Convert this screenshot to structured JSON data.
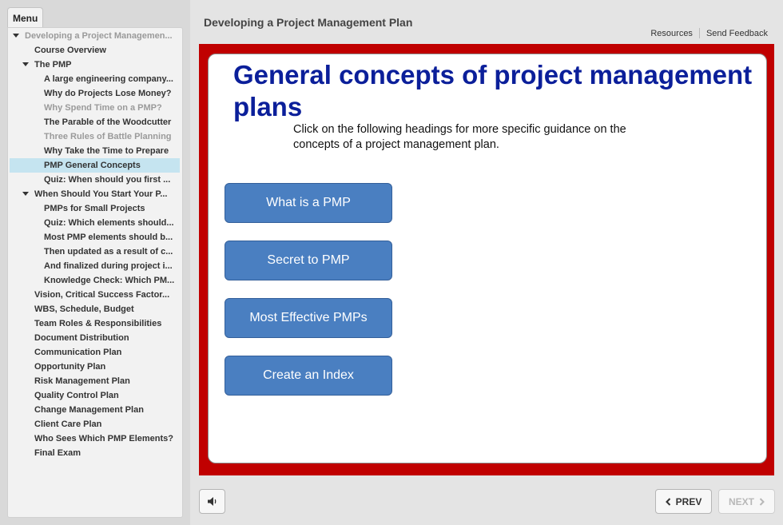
{
  "sidebar": {
    "tab_label": "Menu",
    "items": [
      {
        "label": "Developing a Project Managemen...",
        "level": 0,
        "expanded": true,
        "state": "dim"
      },
      {
        "label": "Course Overview",
        "level": 1,
        "state": "normal"
      },
      {
        "label": "The PMP",
        "level": 0,
        "expanded": true,
        "state": "normal",
        "indent": 1
      },
      {
        "label": "A large engineering company...",
        "level": 2,
        "state": "normal"
      },
      {
        "label": "Why do Projects Lose Money?",
        "level": 2,
        "state": "normal"
      },
      {
        "label": "Why Spend Time on a PMP?",
        "level": 2,
        "state": "dim"
      },
      {
        "label": "The Parable of the Woodcutter",
        "level": 2,
        "state": "normal"
      },
      {
        "label": "Three Rules of Battle Planning",
        "level": 2,
        "state": "dim"
      },
      {
        "label": "Why Take the Time to Prepare",
        "level": 2,
        "state": "normal"
      },
      {
        "label": "PMP General Concepts",
        "level": 2,
        "state": "active"
      },
      {
        "label": "Quiz: When should you first ...",
        "level": 2,
        "state": "normal"
      },
      {
        "label": "When Should You Start Your P...",
        "level": 0,
        "expanded": true,
        "state": "normal",
        "indent": 1
      },
      {
        "label": "PMPs for Small Projects",
        "level": 2,
        "state": "normal"
      },
      {
        "label": "Quiz: Which elements should...",
        "level": 2,
        "state": "normal"
      },
      {
        "label": "Most PMP elements should b...",
        "level": 2,
        "state": "normal"
      },
      {
        "label": "Then updated as a result of c...",
        "level": 2,
        "state": "normal"
      },
      {
        "label": "And finalized during project i...",
        "level": 2,
        "state": "normal"
      },
      {
        "label": "Knowledge Check: Which PM...",
        "level": 2,
        "state": "normal"
      },
      {
        "label": "Vision, Critical Success Factor...",
        "level": 1,
        "state": "normal"
      },
      {
        "label": "WBS, Schedule, Budget",
        "level": 1,
        "state": "normal"
      },
      {
        "label": "Team Roles & Responsibilities",
        "level": 1,
        "state": "normal"
      },
      {
        "label": "Document Distribution",
        "level": 1,
        "state": "normal"
      },
      {
        "label": "Communication Plan",
        "level": 1,
        "state": "normal"
      },
      {
        "label": "Opportunity Plan",
        "level": 1,
        "state": "normal"
      },
      {
        "label": "Risk Management Plan",
        "level": 1,
        "state": "normal"
      },
      {
        "label": "Quality Control Plan",
        "level": 1,
        "state": "normal"
      },
      {
        "label": "Change Management Plan",
        "level": 1,
        "state": "normal"
      },
      {
        "label": "Client Care Plan",
        "level": 1,
        "state": "normal"
      },
      {
        "label": "Who Sees Which PMP Elements?",
        "level": 1,
        "state": "normal"
      },
      {
        "label": "Final Exam",
        "level": 1,
        "state": "normal"
      }
    ]
  },
  "header": {
    "course_title": "Developing a Project Management Plan",
    "resources_label": "Resources",
    "feedback_label": "Send Feedback"
  },
  "slide": {
    "title": "General concepts of project management plans",
    "subtitle": "Click on the following headings for more specific guidance on the concepts of a project management plan.",
    "buttons": [
      {
        "label": "What is a PMP"
      },
      {
        "label": "Secret to PMP"
      },
      {
        "label": "Most Effective PMPs"
      },
      {
        "label": "Create an Index"
      }
    ]
  },
  "footer": {
    "audio_icon": "speaker-icon",
    "prev_label": "PREV",
    "next_label": "NEXT",
    "next_enabled": false
  },
  "colors": {
    "stage_border": "#c00000",
    "title_blue": "#0b1f9a",
    "button_blue": "#4a7fc1",
    "active_item": "#c5e4f0"
  }
}
